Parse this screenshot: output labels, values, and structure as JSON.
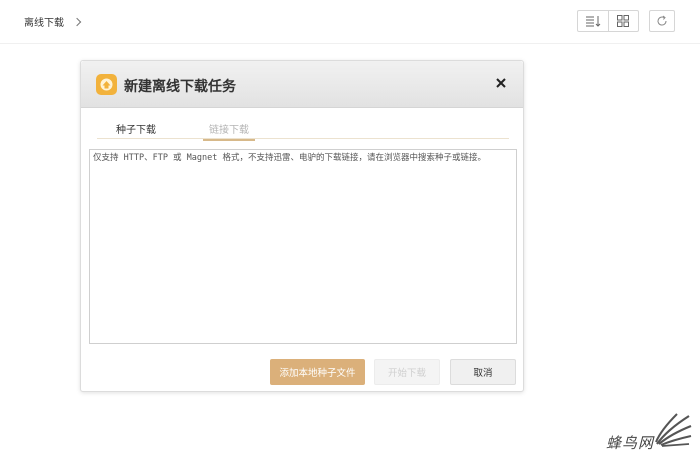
{
  "breadcrumb": {
    "label": "离线下载"
  },
  "toolbar": {
    "view_list_icon": "list-sort-icon",
    "view_grid_icon": "grid-icon",
    "refresh_icon": "refresh-icon"
  },
  "dialog": {
    "title": "新建离线下载任务",
    "tabs": [
      {
        "label": "种子下载",
        "active": false
      },
      {
        "label": "链接下载",
        "active": true
      }
    ],
    "textarea": {
      "value": "",
      "placeholder": "仅支持 HTTP、FTP 或 Magnet 格式，不支持迅雷、电驴的下载链接，请在浏览器中搜索种子或链接。"
    },
    "buttons": {
      "add_local": "添加本地种子文件",
      "start": "开始下载",
      "cancel": "取消"
    }
  },
  "watermark": {
    "text": "蜂鸟网"
  },
  "colors": {
    "accent": "#dbb07a",
    "tab_underline": "#d7b98a",
    "app_icon": "#f2b23c"
  }
}
